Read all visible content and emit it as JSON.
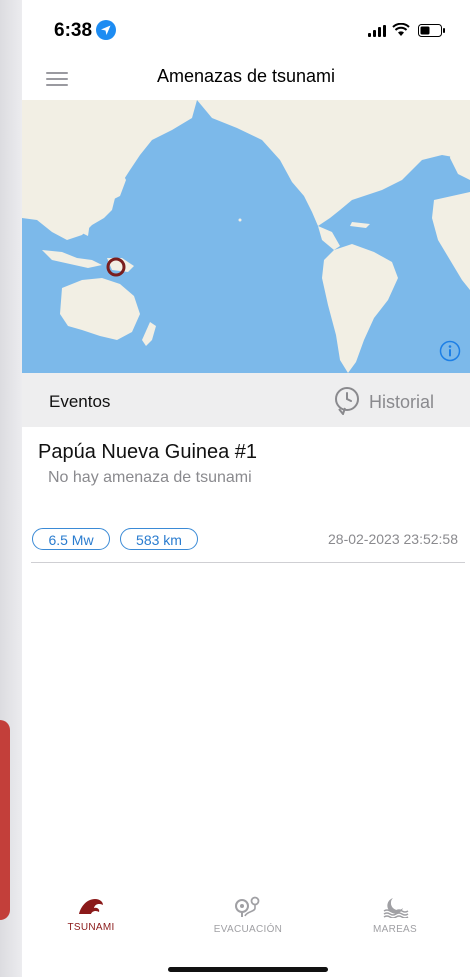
{
  "status_bar": {
    "time": "6:38",
    "location_icon": "location-arrow-icon",
    "signal_icon": "cellular-signal-icon",
    "wifi_icon": "wifi-icon",
    "battery_icon": "battery-icon"
  },
  "nav": {
    "title": "Amenazas de tsunami",
    "menu_icon": "hamburger-menu-icon"
  },
  "map": {
    "marker_color": "#7a1e1e",
    "ocean_color": "#7cb9ea",
    "land_color": "#f2efe4",
    "info_icon": "info-icon"
  },
  "events_header": {
    "label": "Eventos",
    "history_label": "Historial",
    "history_icon": "clock-history-icon"
  },
  "events": [
    {
      "title": "Papúa Nueva Guinea  #1",
      "status": "No hay amenaza de tsunami",
      "magnitude": "6.5 Mw",
      "depth": "583 km",
      "datetime": "28-02-2023 23:52:58"
    }
  ],
  "tabbar": {
    "tabs": [
      {
        "label": "TSUNAMI",
        "icon": "wave-icon",
        "active": true
      },
      {
        "label": "EVACUACIÓN",
        "icon": "route-pin-icon",
        "active": false
      },
      {
        "label": "MAREAS",
        "icon": "tide-moon-icon",
        "active": false
      }
    ]
  },
  "colors": {
    "accent_blue": "#2a7ccf",
    "active_tab": "#8b1a1a",
    "inactive_tab": "#a0a0a4"
  }
}
